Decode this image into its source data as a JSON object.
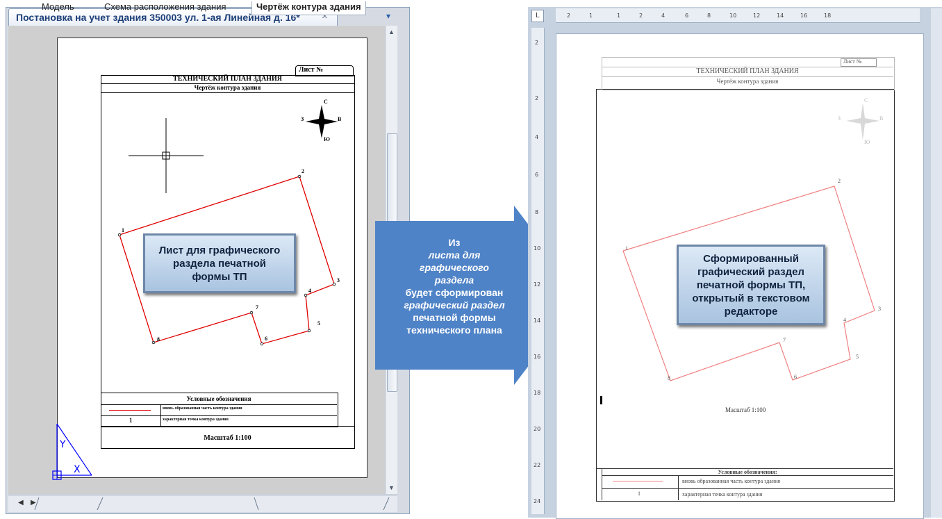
{
  "cad": {
    "tab_title": "Постановка на учет здания 350003 ул. 1-ая Линейная д. 16*",
    "close_glyph": "×",
    "menu_arrow": "▾",
    "sheet_tabs": [
      "Модель",
      "Схема расположения здания",
      "Чертёж контура здания"
    ],
    "nav_prev": "◀",
    "nav_next": "▶",
    "drawing": {
      "sheet_label": "Лист №",
      "title": "ТЕХНИЧЕСКИЙ ПЛАН ЗДАНИЯ",
      "subtitle": "Чертёж контура здания",
      "compass": {
        "n": "С",
        "s": "Ю",
        "w": "З",
        "e": "В"
      },
      "points": [
        "1",
        "2",
        "3",
        "4",
        "5",
        "6",
        "7",
        "8"
      ],
      "legend_title": "Условные обозначения",
      "legend_row1": "вновь образованная часть контура здания",
      "legend_row2": "характерная точка контура здания",
      "legend_num": "1",
      "scale": "Масштаб 1:100",
      "ucs_x": "X",
      "ucs_y": "Y"
    },
    "callout": [
      "Лист для графического",
      "раздела печатной",
      "формы ТП"
    ]
  },
  "arrow_text": {
    "l1": "Из",
    "l2": "листа для",
    "l3": "графического",
    "l4": "раздела",
    "l5": "будет сформирован",
    "l6": "графический раздел",
    "l7": "печатной формы",
    "l8": "технического плана"
  },
  "word": {
    "tab_marker": "L",
    "ruler_marks": [
      "2",
      "1",
      "1",
      "2",
      "4",
      "6",
      "8",
      "10",
      "12",
      "14",
      "16",
      "18"
    ],
    "vruler_marks": [
      "2",
      "2",
      "4",
      "6",
      "8",
      "10",
      "12",
      "14",
      "16",
      "18",
      "20",
      "22",
      "24"
    ],
    "sheet_label": "Лист №",
    "title": "ТЕХНИЧЕСКИЙ ПЛАН ЗДАНИЯ",
    "subtitle": "Чертёж контура здания",
    "compass": {
      "n": "С",
      "s": "Ю",
      "w": "З",
      "e": "В"
    },
    "points": [
      "1",
      "2",
      "3",
      "4",
      "5",
      "6",
      "7",
      "8"
    ],
    "scale": "Масштаб 1:100",
    "legend_title": "Условные обозначения:",
    "legend_row1": "вновь образованная часть контура здания",
    "legend_row2": "характерная точка контура здания",
    "legend_num": "1",
    "callout": [
      "Сформированный",
      "графический раздел",
      "печатной формы ТП,",
      "открытый в текстовом",
      "редакторе"
    ]
  },
  "colors": {
    "contour": "#e00000",
    "contour_word": "#f08080",
    "arrow": "#4f83c7",
    "ucs": "#0000ff"
  }
}
